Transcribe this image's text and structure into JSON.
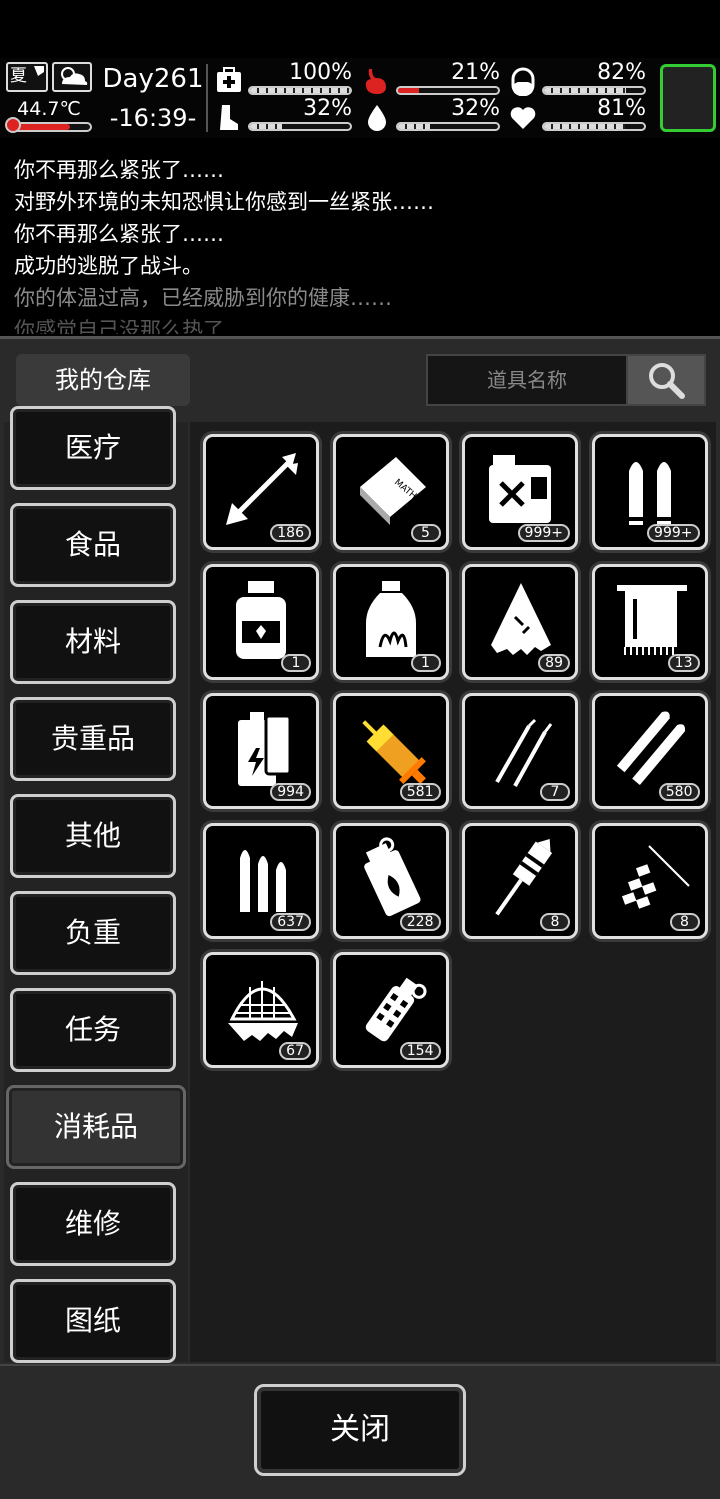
{
  "status": {
    "season": "夏",
    "temperature": "44.7℃",
    "temperature_level": 0.75,
    "day": "Day261",
    "time": "-16:39-",
    "stats": [
      {
        "name": "health",
        "icon": "medkit-icon",
        "value": "100%",
        "level": 1.0
      },
      {
        "name": "hunger",
        "icon": "stomach-icon",
        "value": "21%",
        "level": 0.21
      },
      {
        "name": "mood",
        "icon": "capsule-icon",
        "value": "82%",
        "level": 0.82
      },
      {
        "name": "stamina",
        "icon": "boot-icon",
        "value": "32%",
        "level": 0.32
      },
      {
        "name": "thirst",
        "icon": "water-drop-icon",
        "value": "32%",
        "level": 0.32
      },
      {
        "name": "heart",
        "icon": "heart-icon",
        "value": "81%",
        "level": 0.81
      }
    ],
    "colors": {
      "accent_green": "#33cc33",
      "danger_red": "#dd2222"
    }
  },
  "log": [
    "你不再那么紧张了……",
    "对野外环境的未知恐惧让你感到一丝紧张……",
    "你不再那么紧张了……",
    "成功的逃脱了战斗。",
    "你的体温过高，已经威胁到你的健康……",
    "你感觉自己没那么热了……"
  ],
  "header": {
    "title": "我的仓库",
    "search_placeholder": "道具名称"
  },
  "categories": [
    {
      "label": "医疗",
      "active": false
    },
    {
      "label": "食品",
      "active": false
    },
    {
      "label": "材料",
      "active": false
    },
    {
      "label": "贵重品",
      "active": false
    },
    {
      "label": "其他",
      "active": false
    },
    {
      "label": "负重",
      "active": false
    },
    {
      "label": "任务",
      "active": false
    },
    {
      "label": "消耗品",
      "active": true
    },
    {
      "label": "维修",
      "active": false
    },
    {
      "label": "图纸",
      "active": false
    }
  ],
  "items": [
    {
      "icon": "arrow-icon",
      "count": "186"
    },
    {
      "icon": "math-book-icon",
      "count": "5"
    },
    {
      "icon": "fuel-can-icon",
      "count": "999+"
    },
    {
      "icon": "bullets-icon",
      "count": "999+"
    },
    {
      "icon": "medicine-bottle-icon",
      "count": "1"
    },
    {
      "icon": "herb-bottle-icon",
      "count": "1"
    },
    {
      "icon": "torn-cloth-icon",
      "count": "89"
    },
    {
      "icon": "towel-icon",
      "count": "13"
    },
    {
      "icon": "battery-icon",
      "count": "994"
    },
    {
      "icon": "syringe-icon",
      "count": "581"
    },
    {
      "icon": "lockpick-icon",
      "count": "7"
    },
    {
      "icon": "rifle-rounds-icon",
      "count": "580"
    },
    {
      "icon": "cartridges-icon",
      "count": "637"
    },
    {
      "icon": "incendiary-grenade-icon",
      "count": "228"
    },
    {
      "icon": "firework-rocket-icon",
      "count": "8"
    },
    {
      "icon": "firecrackers-icon",
      "count": "8"
    },
    {
      "icon": "net-trap-icon",
      "count": "67"
    },
    {
      "icon": "flashbang-icon",
      "count": "154"
    }
  ],
  "footer": {
    "close_label": "关闭"
  }
}
